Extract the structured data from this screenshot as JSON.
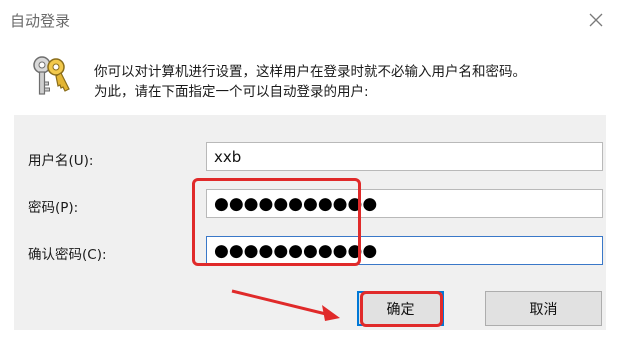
{
  "window": {
    "title": "自动登录",
    "close_icon": "close-icon"
  },
  "description": {
    "icon": "keys-icon",
    "line1": "你可以对计算机进行设置，这样用户在登录时就不必输入用户名和密码。",
    "line2": "为此，请在下面指定一个可以自动登录的用户:"
  },
  "form": {
    "username_label": "用户名(U):",
    "username_value": "xxb",
    "password_label": "密码(P):",
    "password_value": "●●●●●●●●●●●",
    "confirm_label": "确认密码(C):",
    "confirm_value": "●●●●●●●●●●●"
  },
  "buttons": {
    "ok_label": "确定",
    "cancel_label": "取消"
  },
  "annotations": {
    "highlight_color": "#e02a2a"
  }
}
